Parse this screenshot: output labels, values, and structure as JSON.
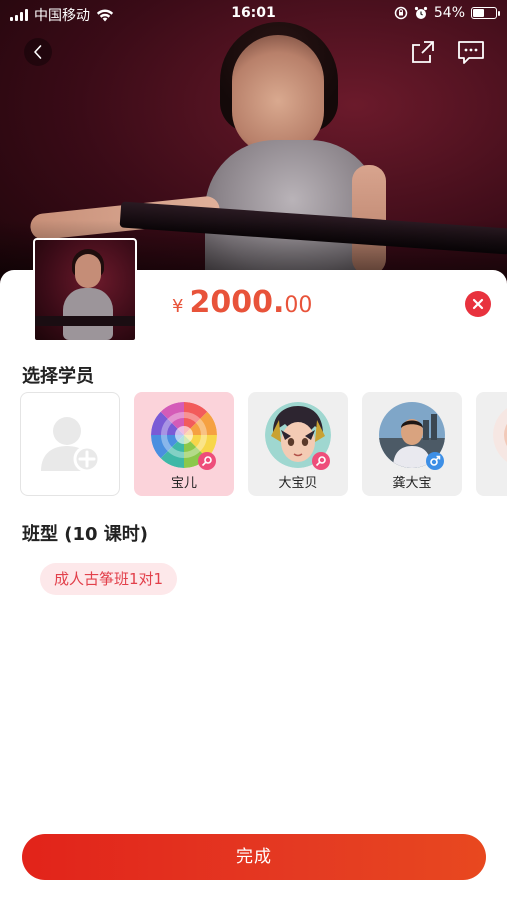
{
  "status_bar": {
    "carrier": "中国移动",
    "time": "16:01",
    "battery": "54%",
    "battery_level": 0.54
  },
  "nav": {
    "back_icon": "chevron-left-icon",
    "share_icon": "share-icon",
    "message_icon": "message-icon"
  },
  "sheet": {
    "price": {
      "currency": "¥",
      "integer": "2000.",
      "decimal": "00",
      "color": "#e8533a"
    },
    "select_student_title": "选择学员",
    "students": [
      {
        "name": "",
        "type": "add"
      },
      {
        "name": "宝儿",
        "gender": "female",
        "selected": true
      },
      {
        "name": "大宝贝",
        "gender": "female",
        "selected": false
      },
      {
        "name": "龚大宝",
        "gender": "male",
        "selected": false
      }
    ],
    "class_type_title": "班型 (10 课时)",
    "class_option": "成人古筝班1对1",
    "done_label": "完成"
  },
  "colors": {
    "accent": "#e8533a",
    "button_gradient_start": "#e2231a",
    "button_gradient_end": "#e8481f",
    "female_badge": "#ee4d7a",
    "male_badge": "#3d8fe6",
    "selected_card": "#fbd3da"
  }
}
